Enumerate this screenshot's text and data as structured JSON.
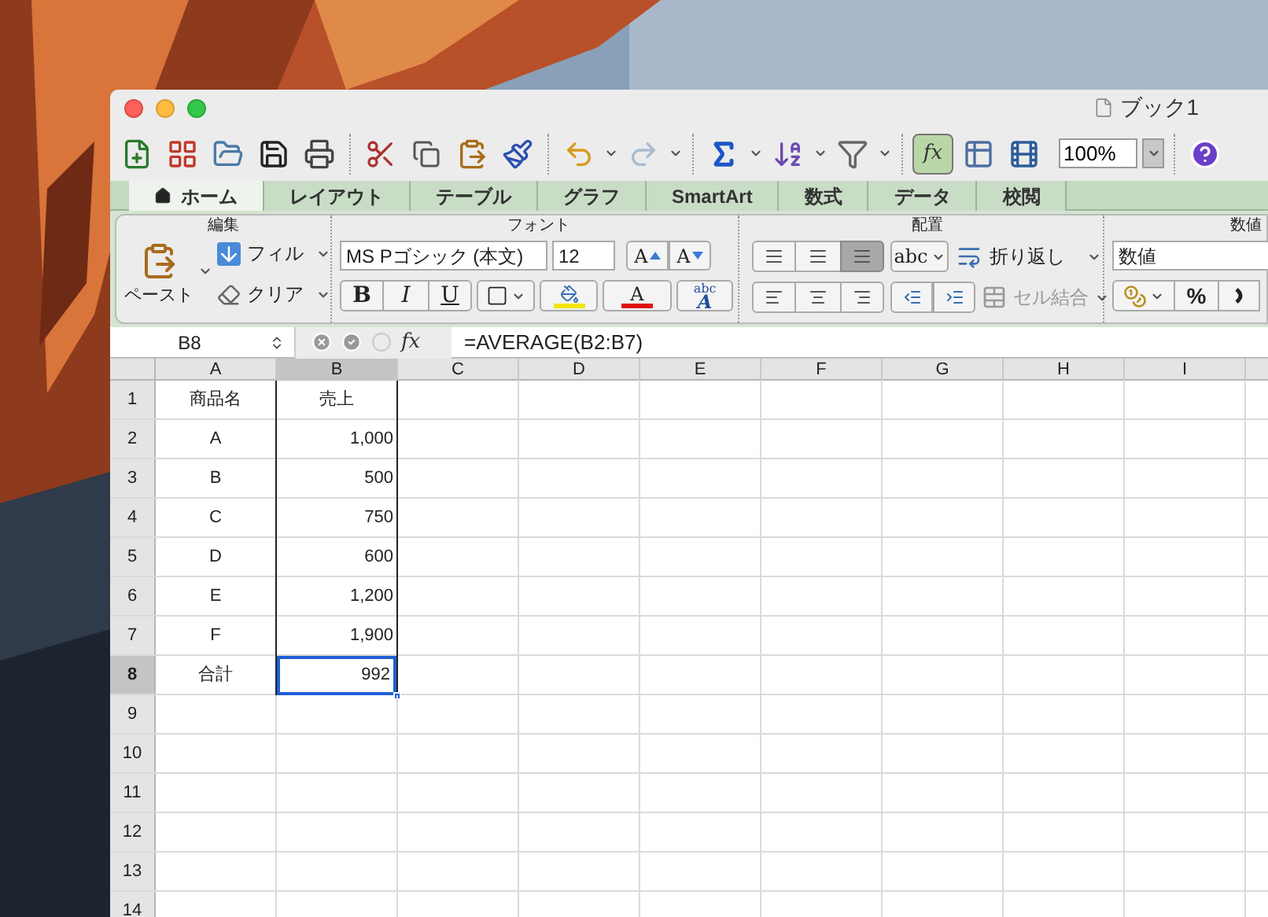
{
  "window": {
    "title": "ブック1"
  },
  "toolbar": {
    "zoom": "100%",
    "formula_button": "fx"
  },
  "tabs": [
    {
      "label": "ホーム",
      "selected": true
    },
    {
      "label": "レイアウト",
      "selected": false
    },
    {
      "label": "テーブル",
      "selected": false
    },
    {
      "label": "グラフ",
      "selected": false
    },
    {
      "label": "SmartArt",
      "selected": false
    },
    {
      "label": "数式",
      "selected": false
    },
    {
      "label": "データ",
      "selected": false
    },
    {
      "label": "校閲",
      "selected": false
    }
  ],
  "ribbon": {
    "edit": {
      "title": "編集",
      "paste": "ペースト",
      "fill": "フィル",
      "clear": "クリア"
    },
    "font": {
      "title": "フォント",
      "font_name": "MS Pゴシック (本文)",
      "font_size": "12",
      "grow": "A",
      "shrink": "A",
      "bold": "B",
      "italic": "I",
      "underline": "U",
      "font_color": "A",
      "styles": "abc",
      "styles_letter": "A"
    },
    "alignment": {
      "title": "配置",
      "orientation": "abc",
      "wrap": "折り返し",
      "merge": {
        "label": "セル結合",
        "disabled": true
      }
    },
    "number": {
      "title": "数値",
      "format": "数値",
      "percent": "%"
    }
  },
  "formula_bar": {
    "name_box": "B8",
    "fx": "fx",
    "formula": "=AVERAGE(B2:B7)"
  },
  "columns": [
    {
      "label": "A",
      "selected": false
    },
    {
      "label": "B",
      "selected": true
    },
    {
      "label": "C",
      "selected": false
    },
    {
      "label": "D",
      "selected": false
    },
    {
      "label": "E",
      "selected": false
    },
    {
      "label": "F",
      "selected": false
    },
    {
      "label": "G",
      "selected": false
    },
    {
      "label": "H",
      "selected": false
    },
    {
      "label": "I",
      "selected": false
    }
  ],
  "rows": [
    {
      "header": "1",
      "selected": false,
      "cells": [
        {
          "text": "商品名",
          "kind": "text",
          "selected": false
        },
        {
          "text": "売上",
          "kind": "text",
          "selected": false
        }
      ]
    },
    {
      "header": "2",
      "selected": false,
      "cells": [
        {
          "text": "A",
          "kind": "text",
          "selected": false
        },
        {
          "text": "1,000",
          "kind": "number",
          "selected": false
        }
      ]
    },
    {
      "header": "3",
      "selected": false,
      "cells": [
        {
          "text": "B",
          "kind": "text",
          "selected": false
        },
        {
          "text": "500",
          "kind": "number",
          "selected": false
        }
      ]
    },
    {
      "header": "4",
      "selected": false,
      "cells": [
        {
          "text": "C",
          "kind": "text",
          "selected": false
        },
        {
          "text": "750",
          "kind": "number",
          "selected": false
        }
      ]
    },
    {
      "header": "5",
      "selected": false,
      "cells": [
        {
          "text": "D",
          "kind": "text",
          "selected": false
        },
        {
          "text": "600",
          "kind": "number",
          "selected": false
        }
      ]
    },
    {
      "header": "6",
      "selected": false,
      "cells": [
        {
          "text": "E",
          "kind": "text",
          "selected": false
        },
        {
          "text": "1,200",
          "kind": "number",
          "selected": false
        }
      ]
    },
    {
      "header": "7",
      "selected": false,
      "cells": [
        {
          "text": "F",
          "kind": "text",
          "selected": false
        },
        {
          "text": "1,900",
          "kind": "number",
          "selected": false
        }
      ]
    },
    {
      "header": "8",
      "selected": true,
      "cells": [
        {
          "text": "合計",
          "kind": "text",
          "selected": false
        },
        {
          "text": "992",
          "kind": "number",
          "selected": true
        }
      ]
    },
    {
      "header": "9",
      "selected": false
    },
    {
      "header": "10",
      "selected": false
    },
    {
      "header": "11",
      "selected": false
    },
    {
      "header": "12",
      "selected": false
    },
    {
      "header": "13",
      "selected": false
    },
    {
      "header": "14",
      "selected": false
    }
  ]
}
